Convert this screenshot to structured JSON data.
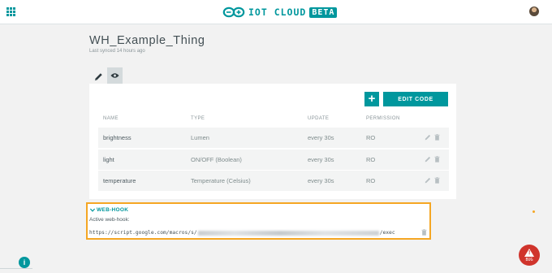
{
  "header": {
    "logo_text": "IOT CLOUD",
    "logo_badge": "BETA"
  },
  "thing": {
    "name": "WH_Example_Thing",
    "last_synced": "Last synced 14 hours ago"
  },
  "toolbar": {
    "add_label": "+",
    "edit_code_label": "EDIT CODE"
  },
  "table": {
    "columns": [
      "NAME",
      "TYPE",
      "UPDATE",
      "PERMISSION"
    ],
    "rows": [
      {
        "name": "brightness",
        "type": "Lumen",
        "update": "every 30s",
        "permission": "RO"
      },
      {
        "name": "light",
        "type": "ON/OFF (Boolean)",
        "update": "every 30s",
        "permission": "RO"
      },
      {
        "name": "temperature",
        "type": "Temperature (Celsius)",
        "update": "every 30s",
        "permission": "RO"
      }
    ]
  },
  "webhook": {
    "title": "WEB-HOOK",
    "label": "Active web-hook:",
    "url_prefix": "https://script.google.com/macros/s/",
    "url_suffix": "/exec"
  },
  "info_label": "i",
  "warning_label": "BUG",
  "colors": {
    "accent": "#00979d",
    "highlight_border": "#f5a623",
    "warning": "#d0342c"
  }
}
